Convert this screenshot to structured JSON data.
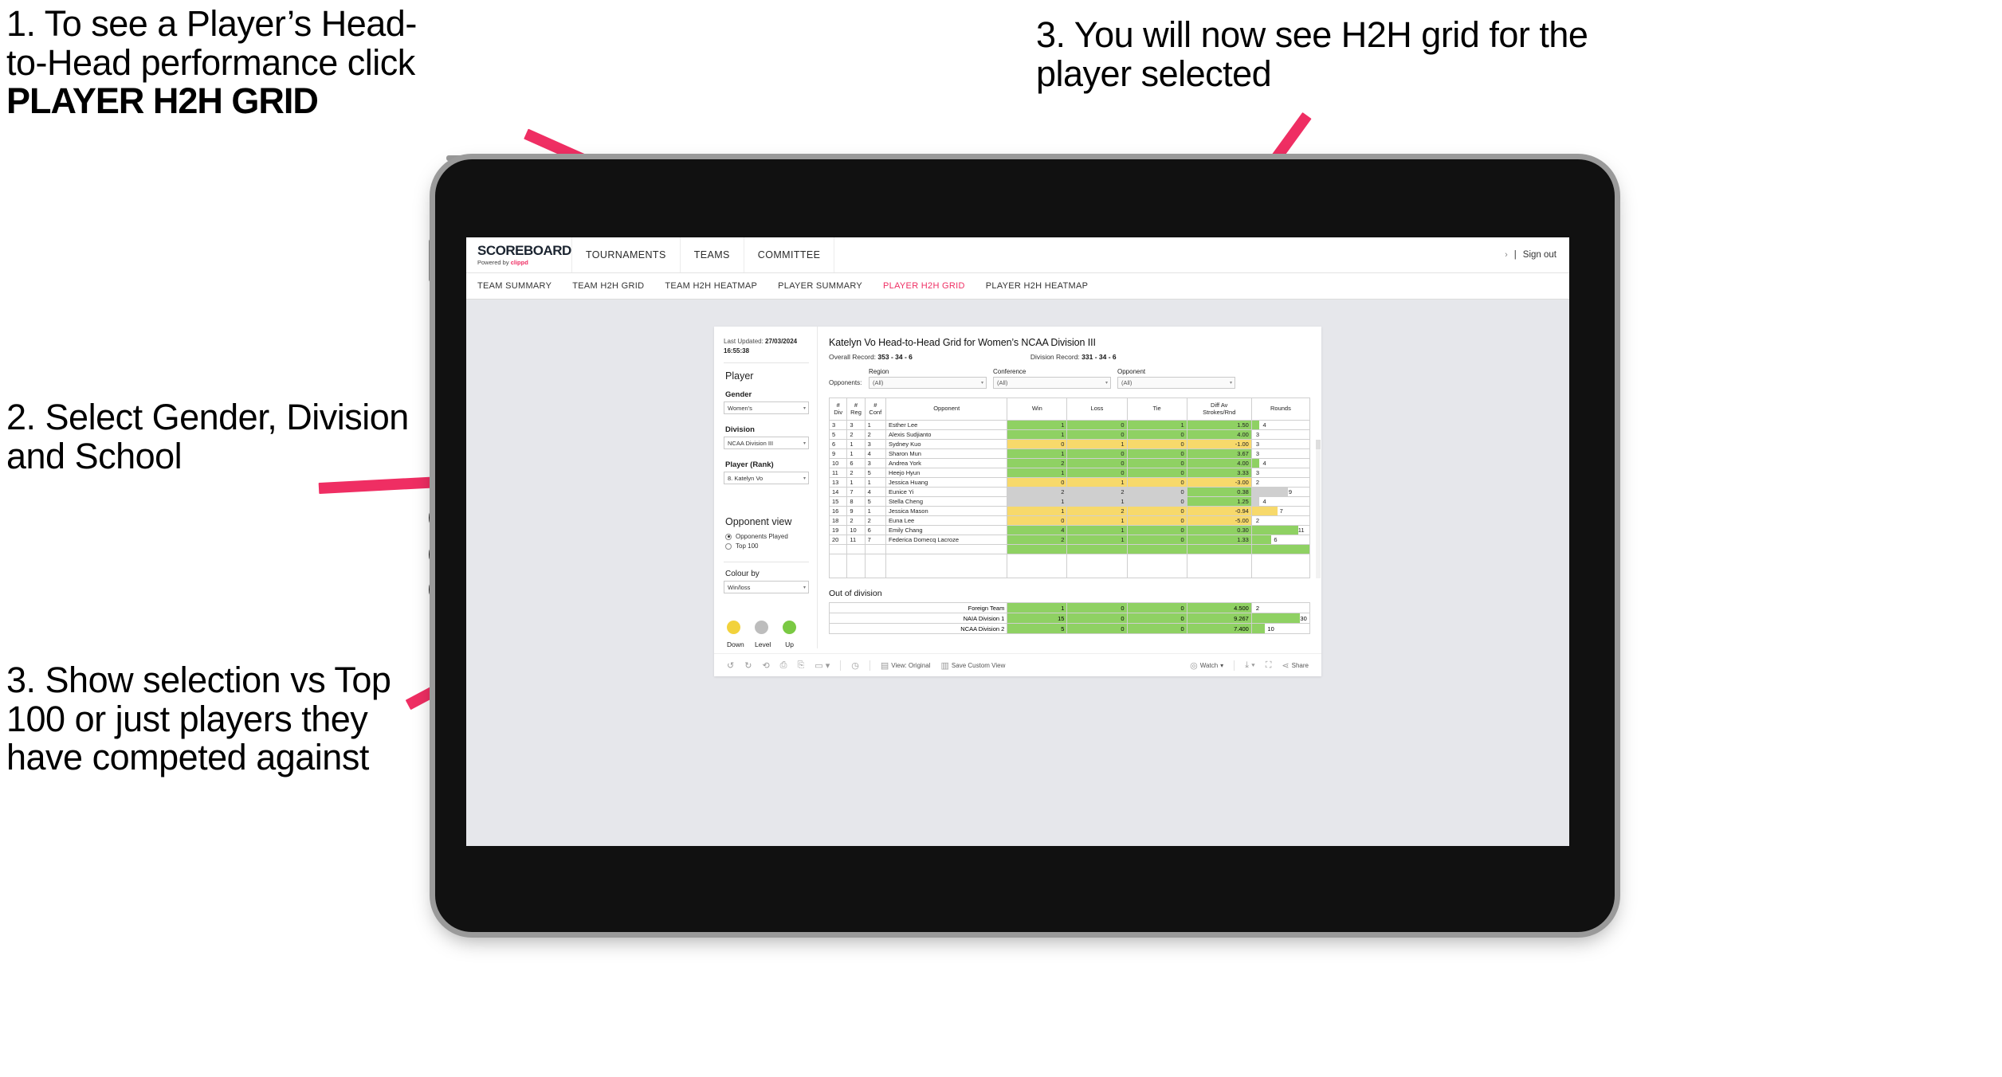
{
  "annotations": {
    "note1_line1": "1. To see a Player’s Head-",
    "note1_line2": "to-Head performance click",
    "note1_bold": "PLAYER H2H GRID",
    "note2": "2. Select Gender, Division and School",
    "note3": "3. Show selection vs Top 100 or just players they have competed against",
    "note4": "3. You will now see H2H grid for the player selected"
  },
  "app": {
    "logo_main": "SCOREBOARD",
    "logo_sub_prefix": "Powered by ",
    "logo_sub_brand": "clippd",
    "nav": [
      {
        "label": "TOURNAMENTS"
      },
      {
        "label": "TEAMS"
      },
      {
        "label": "COMMITTEE"
      }
    ],
    "signout_chevron": "›",
    "signout_divider": "|",
    "signout_label": "Sign out",
    "subnav": [
      {
        "label": "TEAM SUMMARY",
        "active": false
      },
      {
        "label": "TEAM H2H GRID",
        "active": false
      },
      {
        "label": "TEAM H2H HEATMAP",
        "active": false
      },
      {
        "label": "PLAYER SUMMARY",
        "active": false
      },
      {
        "label": "PLAYER H2H GRID",
        "active": true
      },
      {
        "label": "PLAYER H2H HEATMAP",
        "active": false
      }
    ],
    "accent_color": "#ef2e63"
  },
  "viz": {
    "sidebar": {
      "last_updated_label": "Last Updated: ",
      "last_updated_date": "27/03/2024",
      "last_updated_time": "16:55:38",
      "player_heading": "Player",
      "gender_label": "Gender",
      "gender_value": "Women's",
      "division_label": "Division",
      "division_value": "NCAA Division III",
      "player_rank_label": "Player (Rank)",
      "player_rank_value": "8. Katelyn Vo",
      "opponent_view_heading": "Opponent view",
      "opponent_view_options": [
        {
          "label": "Opponents Played",
          "selected": true
        },
        {
          "label": "Top 100",
          "selected": false
        }
      ],
      "colour_by_label": "Colour by",
      "colour_by_value": "Win/loss",
      "legend": [
        {
          "label": "Down",
          "color": "#f2d23c"
        },
        {
          "label": "Level",
          "color": "#bdbdbd"
        },
        {
          "label": "Up",
          "color": "#7ac943"
        }
      ]
    },
    "main": {
      "title": "Katelyn Vo Head-to-Head Grid for Women’s NCAA Division III",
      "overall_record_label": "Overall Record: ",
      "overall_record_value": "353 -  34 - 6",
      "division_record_label": "Division Record: ",
      "division_record_value": "331 -  34 - 6",
      "opponents_label": "Opponents:",
      "filters": [
        {
          "heading": "Region",
          "value": "(All)"
        },
        {
          "heading": "Conference",
          "value": "(All)"
        },
        {
          "heading": "Opponent",
          "value": "(All)"
        }
      ],
      "out_of_division_heading": "Out of division"
    },
    "toolbar": {
      "view_label": "View: Original",
      "save_label": "Save Custom View",
      "watch_label": "Watch",
      "share_label": "Share"
    }
  },
  "chart_data": {
    "type": "table",
    "title": "Katelyn Vo Head-to-Head Grid for Women’s NCAA Division III",
    "columns": [
      "# Div",
      "# Reg",
      "# Conf",
      "Opponent",
      "Win",
      "Loss",
      "Tie",
      "Diff Av Strokes/Rnd",
      "Rounds"
    ],
    "column_headers_multiline": [
      [
        "#",
        "Div"
      ],
      [
        "#",
        "Reg"
      ],
      [
        "#",
        "Conf"
      ],
      [
        "Opponent"
      ],
      [
        "Win"
      ],
      [
        "Loss"
      ],
      [
        "Tie"
      ],
      [
        "Diff Av",
        "Strokes/Rnd"
      ],
      [
        "Rounds"
      ]
    ],
    "rows": [
      {
        "div": "3",
        "reg": "3",
        "conf": "1",
        "opponent": "Esther Lee",
        "win": "1",
        "loss": "0",
        "tie": "1",
        "diff": "1.50",
        "rounds": "4",
        "color": "up",
        "rounds_pct": 13
      },
      {
        "div": "5",
        "reg": "2",
        "conf": "2",
        "opponent": "Alexis Sudjianto",
        "win": "1",
        "loss": "0",
        "tie": "0",
        "diff": "4.00",
        "rounds": "3",
        "color": "up",
        "rounds_pct": 0
      },
      {
        "div": "6",
        "reg": "1",
        "conf": "3",
        "opponent": "Sydney Kuo",
        "win": "0",
        "loss": "1",
        "tie": "0",
        "diff": "-1.00",
        "rounds": "3",
        "color": "down",
        "rounds_pct": 0
      },
      {
        "div": "9",
        "reg": "1",
        "conf": "4",
        "opponent": "Sharon Mun",
        "win": "1",
        "loss": "0",
        "tie": "0",
        "diff": "3.67",
        "rounds": "3",
        "color": "up",
        "rounds_pct": 0
      },
      {
        "div": "10",
        "reg": "6",
        "conf": "3",
        "opponent": "Andrea York",
        "win": "2",
        "loss": "0",
        "tie": "0",
        "diff": "4.00",
        "rounds": "4",
        "color": "up",
        "rounds_pct": 13
      },
      {
        "div": "11",
        "reg": "2",
        "conf": "5",
        "opponent": "Heejo Hyun",
        "win": "1",
        "loss": "0",
        "tie": "0",
        "diff": "3.33",
        "rounds": "3",
        "color": "up",
        "rounds_pct": 0
      },
      {
        "div": "13",
        "reg": "1",
        "conf": "1",
        "opponent": "Jessica Huang",
        "win": "0",
        "loss": "1",
        "tie": "0",
        "diff": "-3.00",
        "rounds": "2",
        "color": "down",
        "rounds_pct": 0
      },
      {
        "div": "14",
        "reg": "7",
        "conf": "4",
        "opponent": "Eunice Yi",
        "win": "2",
        "loss": "2",
        "tie": "0",
        "diff": "0.38",
        "rounds": "9",
        "color": "level",
        "rounds_pct": 62
      },
      {
        "div": "15",
        "reg": "8",
        "conf": "5",
        "opponent": "Stella Cheng",
        "win": "1",
        "loss": "1",
        "tie": "0",
        "diff": "1.25",
        "rounds": "4",
        "color": "level",
        "rounds_pct": 13
      },
      {
        "div": "16",
        "reg": "9",
        "conf": "1",
        "opponent": "Jessica Mason",
        "win": "1",
        "loss": "2",
        "tie": "0",
        "diff": "-0.94",
        "rounds": "7",
        "color": "down",
        "rounds_pct": 45
      },
      {
        "div": "18",
        "reg": "2",
        "conf": "2",
        "opponent": "Euna Lee",
        "win": "0",
        "loss": "1",
        "tie": "0",
        "diff": "-5.00",
        "rounds": "2",
        "color": "down",
        "rounds_pct": 0
      },
      {
        "div": "19",
        "reg": "10",
        "conf": "6",
        "opponent": "Emily Chang",
        "win": "4",
        "loss": "1",
        "tie": "0",
        "diff": "0.30",
        "rounds": "11",
        "color": "up",
        "rounds_pct": 80
      },
      {
        "div": "20",
        "reg": "11",
        "conf": "7",
        "opponent": "Federica Domecq Lacroze",
        "win": "2",
        "loss": "1",
        "tie": "0",
        "diff": "1.33",
        "rounds": "6",
        "color": "up",
        "rounds_pct": 34
      }
    ],
    "out_of_division": [
      {
        "label": "Foreign Team",
        "win": "1",
        "loss": "0",
        "tie": "0",
        "diff": "4.500",
        "rounds": "2",
        "color": "up",
        "rounds_pct": 0
      },
      {
        "label": "NAIA Division 1",
        "win": "15",
        "loss": "0",
        "tie": "0",
        "diff": "9.267",
        "rounds": "30",
        "color": "up",
        "rounds_pct": 84
      },
      {
        "label": "NCAA Division 2",
        "win": "5",
        "loss": "0",
        "tie": "0",
        "diff": "7.400",
        "rounds": "10",
        "color": "up",
        "rounds_pct": 22
      }
    ],
    "color_map": {
      "up": "#8fd163",
      "down": "#f7d96b",
      "level": "#cfcfcf"
    }
  }
}
